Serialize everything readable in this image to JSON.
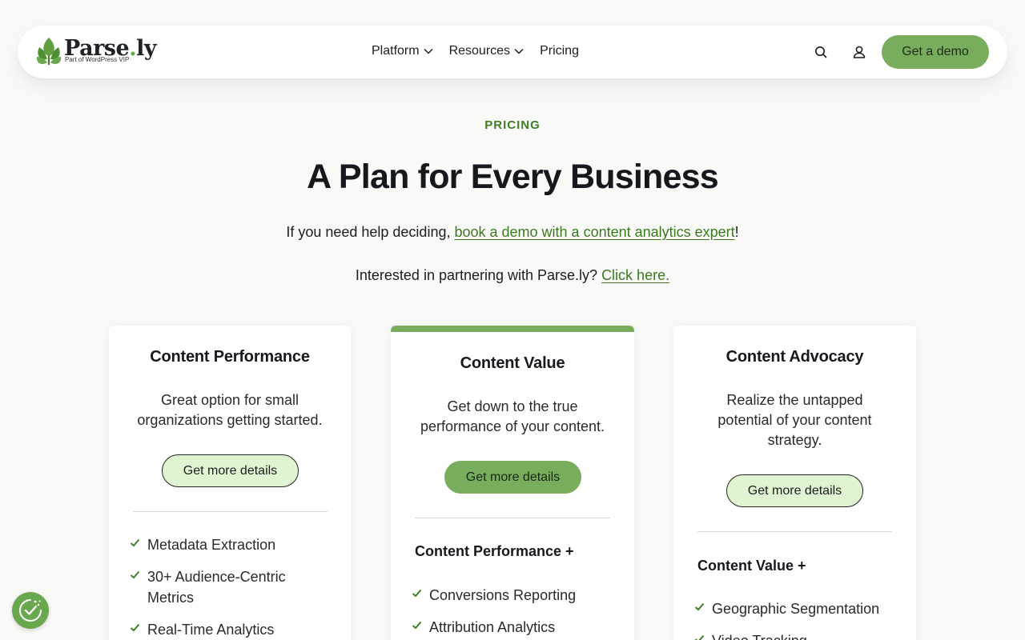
{
  "header": {
    "logo_word": "Parse",
    "logo_dot": ".",
    "logo_suffix": "ly",
    "logo_sub": "Part of WordPress VIP",
    "nav": [
      {
        "label": "Platform"
      },
      {
        "label": "Resources"
      },
      {
        "label": "Pricing"
      }
    ],
    "demo_label": "Get a demo"
  },
  "hero": {
    "eyebrow": "PRICING",
    "title": "A Plan for Every Business",
    "help_prefix": "If you need help deciding, ",
    "help_link": "book a demo with a content analytics expert",
    "help_suffix": "!",
    "partner_prefix": "Interested in partnering with Parse.ly? ",
    "partner_link": "Click here."
  },
  "plans": [
    {
      "name": "Content Performance",
      "description": "Great option for small organizations getting started.",
      "button": "Get more details",
      "includes": "",
      "features": [
        "Metadata Extraction",
        "30+ Audience-Centric Metrics",
        "Real-Time Analytics"
      ]
    },
    {
      "name": "Content Value",
      "description": "Get down to the true performance of your content.",
      "button": "Get more details",
      "includes": "Content Performance +",
      "features": [
        "Conversions Reporting",
        "Attribution Analytics"
      ]
    },
    {
      "name": "Content Advocacy",
      "description": "Realize the untapped potential of your content strategy.",
      "button": "Get more details",
      "includes": "Content Value +",
      "features": [
        "Geographic Segmentation",
        "Video Tracking"
      ]
    }
  ],
  "colors": {
    "accent": "#78ad5e",
    "accent_dark": "#3f7e22",
    "button_light": "#e1f4d2"
  },
  "icons": {
    "search": "search-icon",
    "user": "user-icon",
    "check": "check-icon",
    "consent": "cookie-consent-icon"
  }
}
